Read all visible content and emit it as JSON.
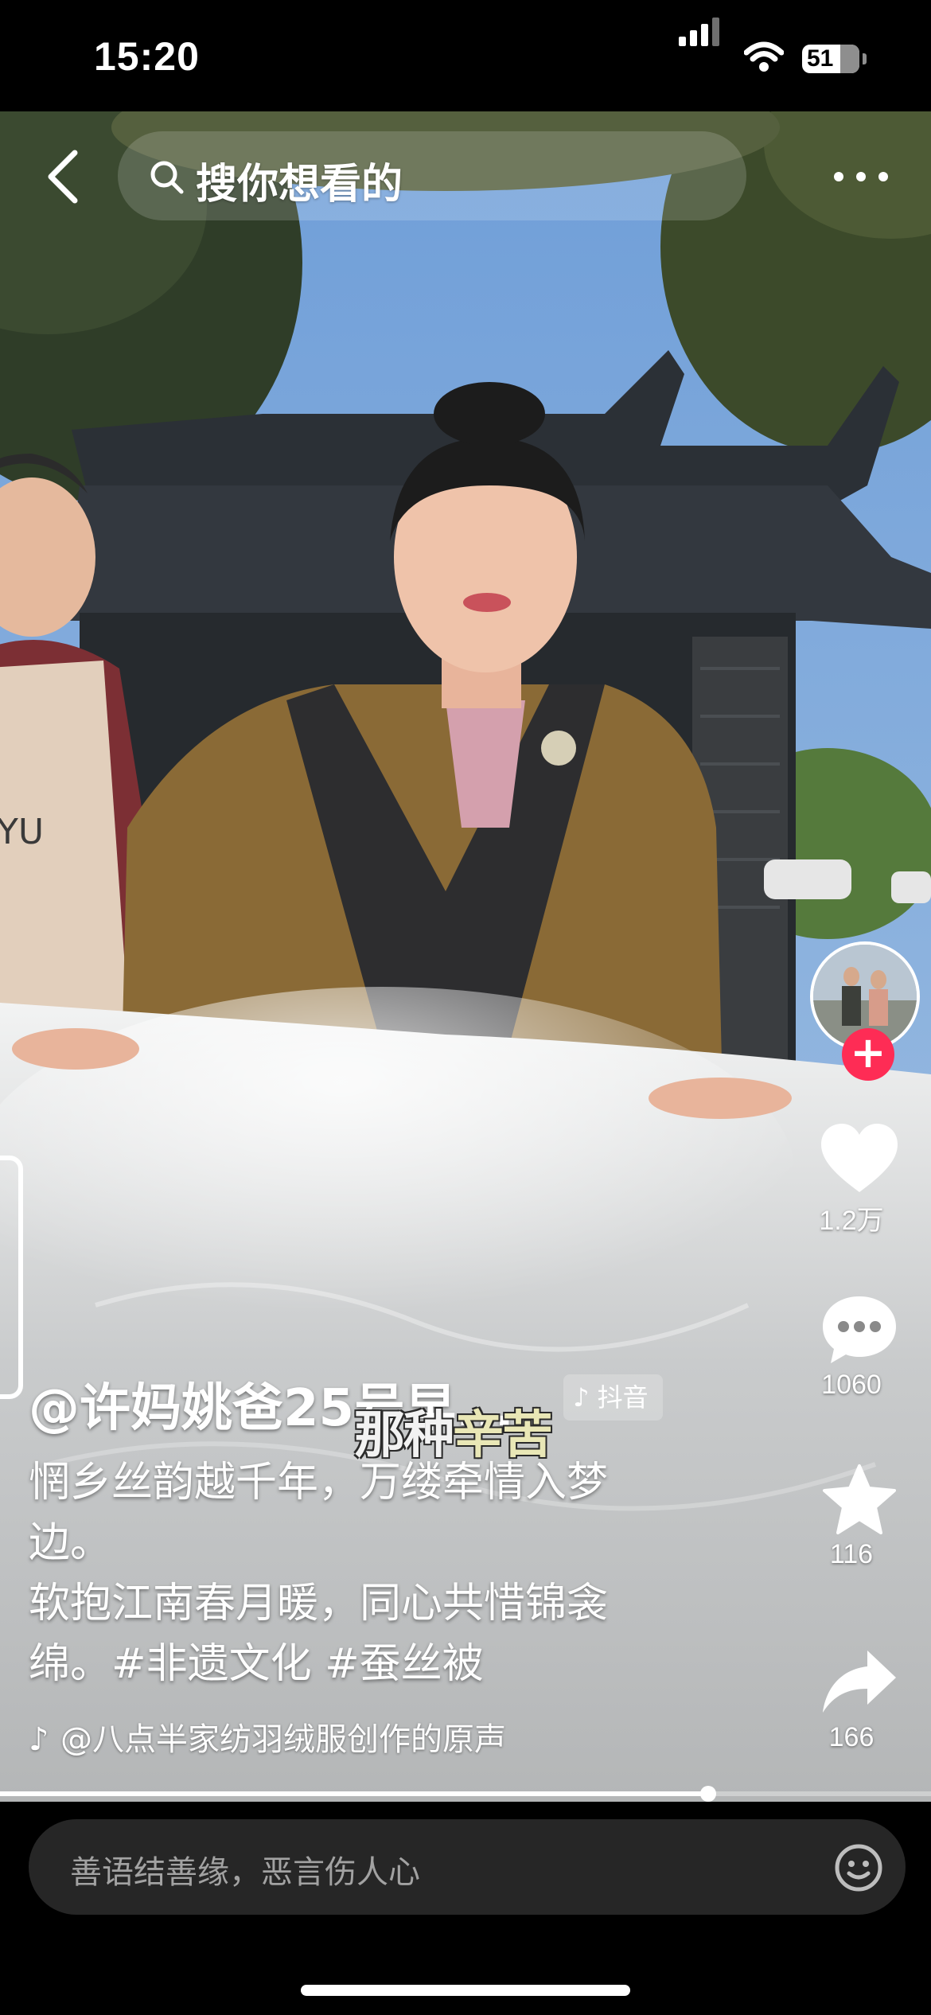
{
  "status_bar": {
    "time": "15:20",
    "battery": "51",
    "icons": [
      "cellular-signal-icon",
      "wifi-icon",
      "battery-icon"
    ]
  },
  "top_bar": {
    "back_icon": "chevron-left-icon",
    "search_placeholder": "搜你想看的",
    "more_icon": "more-dots-icon"
  },
  "video": {
    "subtitle_part1": "那种",
    "subtitle_part2": "辛苦",
    "watermark": "抖音",
    "apron_text": "YU"
  },
  "right_rail": {
    "likes": "1.2万",
    "comments": "1060",
    "favorites": "116",
    "shares": "166",
    "follow_symbol": "+"
  },
  "caption": {
    "author": "@许妈姚爸25号早...",
    "lines": [
      "惘乡丝韵越千年，万缕牵情入梦",
      "边。",
      "软抱江南春月暖，同心共惜锦衾",
      "绵。#非遗文化 #蚕丝被"
    ],
    "music": "@八点半家纺羽绒服创作的原声"
  },
  "progress": {
    "fraction": 0.761
  },
  "bottom": {
    "comment_placeholder": "善语结善缘，恶言伤人心",
    "emoji_icon": "emoji-smile-icon"
  },
  "colors": {
    "accent_pink": "#fe2c55",
    "sky": "#7fa7d4",
    "input_bg": "#262626"
  }
}
